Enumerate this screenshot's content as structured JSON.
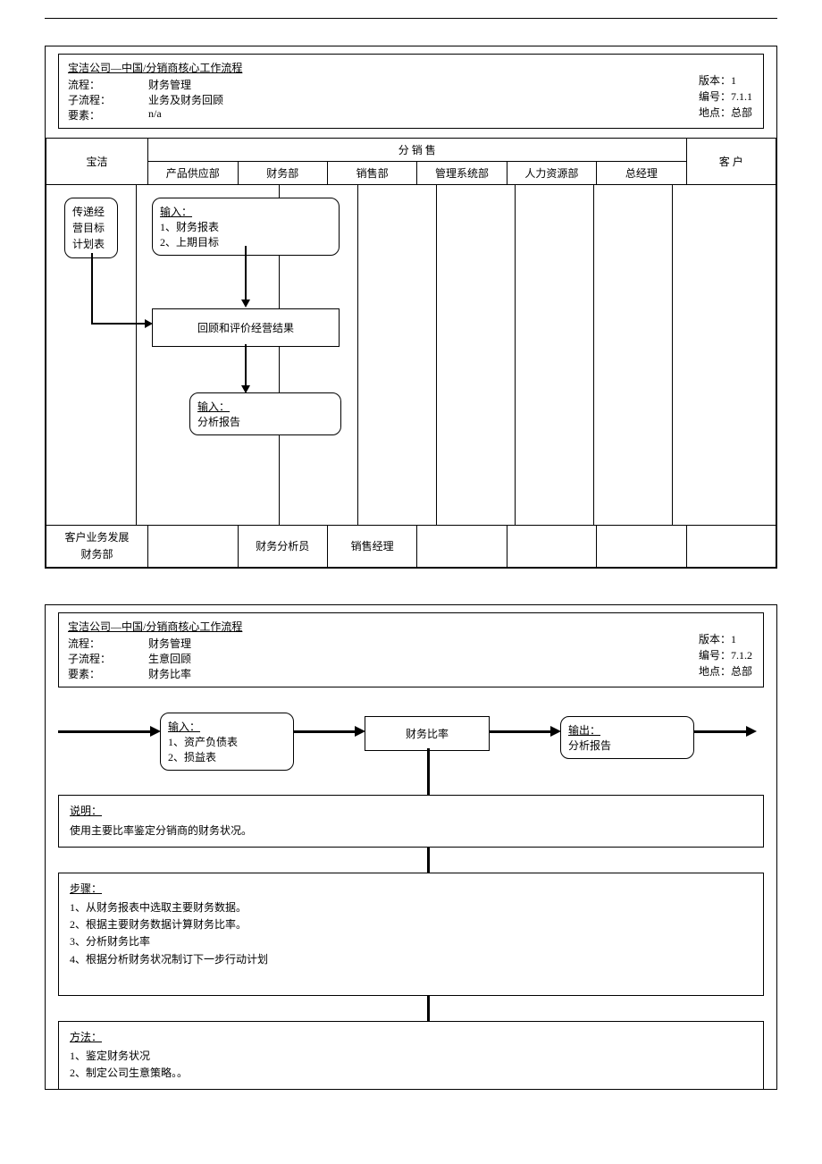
{
  "diagram1": {
    "title": "宝洁公司—中国/分销商核心工作流程",
    "meta_left": [
      {
        "label": "流程：",
        "value": "财务管理"
      },
      {
        "label": "子流程：",
        "value": "业务及财务回顾"
      },
      {
        "label": "要素：",
        "value": "n/a"
      }
    ],
    "meta_right": [
      "版本：1",
      "编号：7.1.1",
      "地点：总部"
    ],
    "lanes": {
      "pg": "宝洁",
      "group": "分    销    售",
      "sub": [
        "产品供应部",
        "财务部",
        "销售部",
        "管理系统部",
        "人力资源部",
        "总经理"
      ],
      "customer": "客    户"
    },
    "nodes": {
      "n1": "传递经\n营目标\n计划表",
      "n2_title": "输入：",
      "n2_lines": [
        "1、财务报表",
        "2、上期目标"
      ],
      "n3": "回顾和评价经营结果",
      "n4_title": "输入：",
      "n4_lines": [
        "分析报告"
      ]
    },
    "footer": {
      "pg": [
        "客户业务发展",
        "财务部"
      ],
      "finance": "财务分析员",
      "sales": "销售经理"
    }
  },
  "diagram2": {
    "title": "宝洁公司—中国/分销商核心工作流程",
    "meta_left": [
      {
        "label": "流程：",
        "value": "财务管理"
      },
      {
        "label": "子流程：",
        "value": "生意回顾"
      },
      {
        "label": "要素：",
        "value": "财务比率"
      }
    ],
    "meta_right": [
      "版本：1",
      "编号：7.1.2",
      "地点：总部"
    ],
    "input_title": "输入：",
    "input_lines": [
      "1、资产负债表",
      "2、损益表"
    ],
    "center": "财务比率",
    "output_title": "输出：",
    "output_lines": [
      "分析报告"
    ],
    "desc_title": "说明：",
    "desc_body": "使用主要比率鉴定分销商的财务状况。",
    "steps_title": "步骤：",
    "steps": [
      "1、从财务报表中选取主要财务数据。",
      "2、根据主要财务数据计算财务比率。",
      "3、分析财务比率",
      "4、根据分析财务状况制订下一步行动计划"
    ],
    "method_title": "方法：",
    "methods": [
      "1、鉴定财务状况",
      "2、制定公司生意策略。。"
    ]
  }
}
